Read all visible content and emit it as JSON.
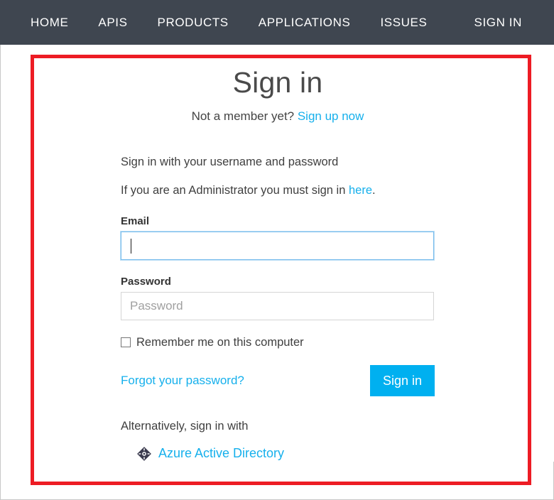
{
  "nav": {
    "items": [
      {
        "label": "HOME",
        "name": "nav-item-home"
      },
      {
        "label": "APIS",
        "name": "nav-item-apis"
      },
      {
        "label": "PRODUCTS",
        "name": "nav-item-products"
      },
      {
        "label": "APPLICATIONS",
        "name": "nav-item-applications"
      },
      {
        "label": "ISSUES",
        "name": "nav-item-issues"
      }
    ],
    "sign_in": "SIGN IN",
    "background": "#3f4650",
    "text_color": "#ffffff"
  },
  "annotation": {
    "color": "#ed1c24",
    "shape": "rectangle-highlight"
  },
  "signin": {
    "title": "Sign in",
    "member_prompt": "Not a member yet? ",
    "signup_link": "Sign up now",
    "intro": "Sign in with your username and password",
    "admin_prefix": "If you are an Administrator you must sign in ",
    "admin_link": "here",
    "admin_suffix": ".",
    "email": {
      "label": "Email",
      "value": "",
      "placeholder": "",
      "focused": true
    },
    "password": {
      "label": "Password",
      "value": "",
      "placeholder": "Password",
      "focused": false
    },
    "remember": {
      "label": "Remember me on this computer",
      "checked": false
    },
    "forgot_link": "Forgot your password?",
    "submit_label": "Sign in",
    "alternative_text": "Alternatively, sign in with",
    "provider": {
      "label": "Azure Active Directory",
      "icon": "azure-active-directory-icon"
    },
    "accent_color": "#00b0f0",
    "link_color": "#16b0ec",
    "focus_border_color": "#77bcec"
  }
}
